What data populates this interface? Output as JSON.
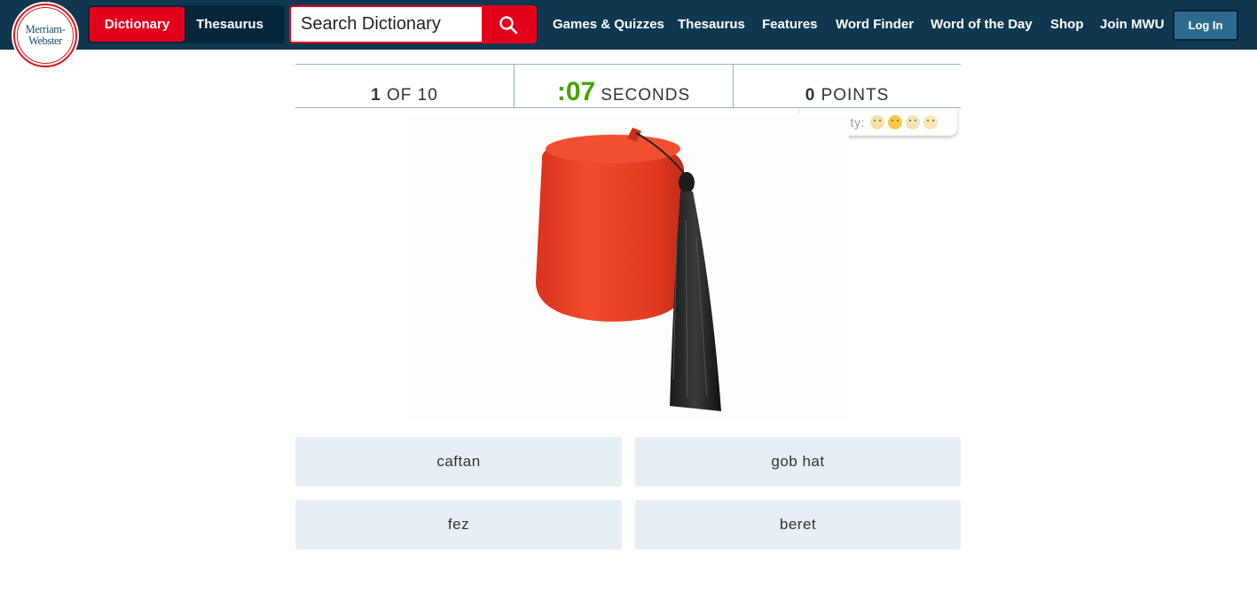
{
  "header": {
    "logo_line1": "Merriam-",
    "logo_line2": "Webster",
    "dictionary_tab": "Dictionary",
    "thesaurus_tab": "Thesaurus",
    "search_placeholder": "Search Dictionary",
    "nav": [
      "Games & Quizzes",
      "Thesaurus",
      "Features",
      "Word Finder",
      "Word of the Day",
      "Shop",
      "Join MWU"
    ],
    "login_label": "Log In",
    "colors": {
      "bar": "#0f3850",
      "accent": "#e3001b",
      "login": "#2c6b8f"
    }
  },
  "quiz": {
    "question_number": "1",
    "question_total_text": "OF 10",
    "timer_value": ":07",
    "timer_unit": "SECONDS",
    "points_value": "0",
    "points_unit": "POINTS",
    "difficulty_label": "Difficulty:",
    "difficulty_icons": [
      "easy-face-icon",
      "medium-face-icon",
      "hard-face-icon",
      "shocked-face-icon"
    ],
    "image_subject": "red-fez-with-black-tassel",
    "answers": [
      "caftan",
      "gob hat",
      "fez",
      "beret"
    ],
    "colors": {
      "timer": "#46a300",
      "answer_bg": "#e5eff5"
    }
  }
}
